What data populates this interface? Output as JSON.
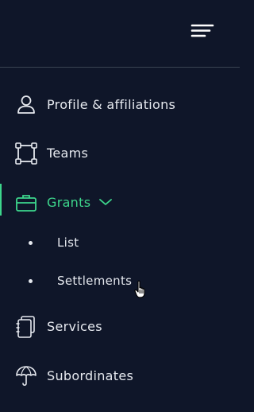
{
  "sidebar": {
    "menu_icon": "menu-lines-icon",
    "items": [
      {
        "label": "Profile & affiliations",
        "icon": "user-icon"
      },
      {
        "label": "Teams",
        "icon": "frame-icon"
      },
      {
        "label": "Grants",
        "icon": "briefcase-icon",
        "active": true,
        "expanded": true,
        "children": [
          {
            "label": "List"
          },
          {
            "label": "Settlements"
          }
        ]
      },
      {
        "label": "Services",
        "icon": "notebook-icon"
      },
      {
        "label": "Subordinates",
        "icon": "umbrella-icon"
      }
    ]
  },
  "colors": {
    "background": "#0f1629",
    "text": "#e6e9ef",
    "accent": "#3dd68c",
    "divider": "#3a4352"
  }
}
